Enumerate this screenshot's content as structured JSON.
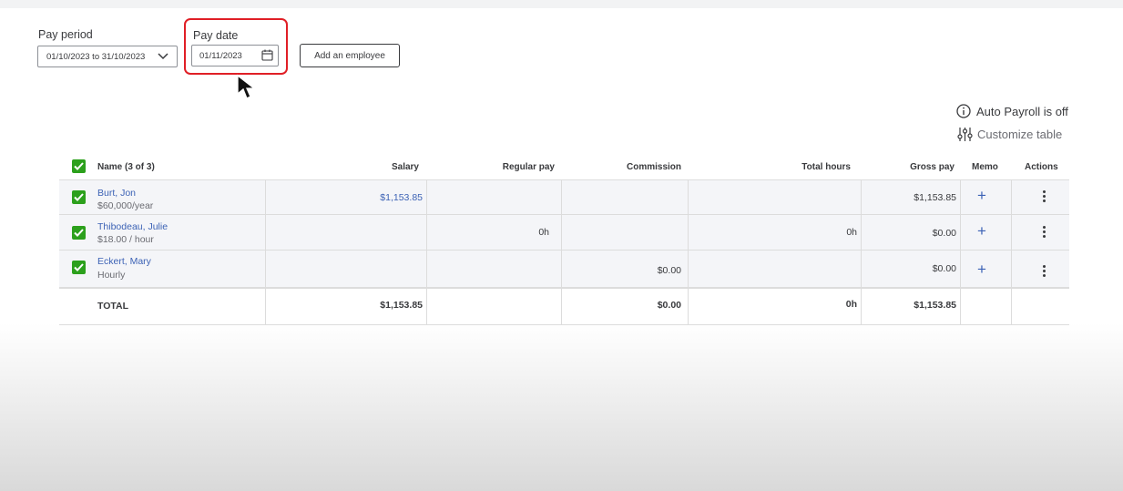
{
  "filters": {
    "pay_period_label": "Pay period",
    "pay_period_value": "01/10/2023 to 31/10/2023",
    "pay_date_label": "Pay date",
    "pay_date_value": "01/11/2023",
    "add_employee_label": "Add an employee"
  },
  "toolbar": {
    "auto_payroll": "Auto Payroll is off",
    "customize": "Customize table"
  },
  "table": {
    "headers": {
      "name": "Name (3 of 3)",
      "salary": "Salary",
      "regular_pay": "Regular pay",
      "commission": "Commission",
      "total_hours": "Total hours",
      "gross_pay": "Gross pay",
      "memo": "Memo",
      "actions": "Actions"
    },
    "rows": [
      {
        "name": "Burt, Jon",
        "rate": "$60,000/year",
        "salary": "$1,153.85",
        "regular_pay": "",
        "commission": "",
        "total_hours": "",
        "gross_pay": "$1,153.85",
        "memo": "+"
      },
      {
        "name": "Thibodeau, Julie",
        "rate": "$18.00 / hour",
        "salary": "",
        "regular_pay": "0h",
        "commission": "",
        "total_hours": "0h",
        "gross_pay": "$0.00",
        "memo": "+"
      },
      {
        "name": "Eckert, Mary",
        "rate": "Hourly",
        "salary": "",
        "regular_pay": "",
        "commission": "$0.00",
        "total_hours": "",
        "gross_pay": "$0.00",
        "memo": "+"
      }
    ],
    "total": {
      "label": "TOTAL",
      "salary": "$1,153.85",
      "commission": "$0.00",
      "total_hours": "0h",
      "gross_pay": "$1,153.85"
    }
  },
  "colors": {
    "accent_green": "#2ca01c",
    "link_blue": "#3c62b5",
    "highlight_red": "#e01f26"
  }
}
